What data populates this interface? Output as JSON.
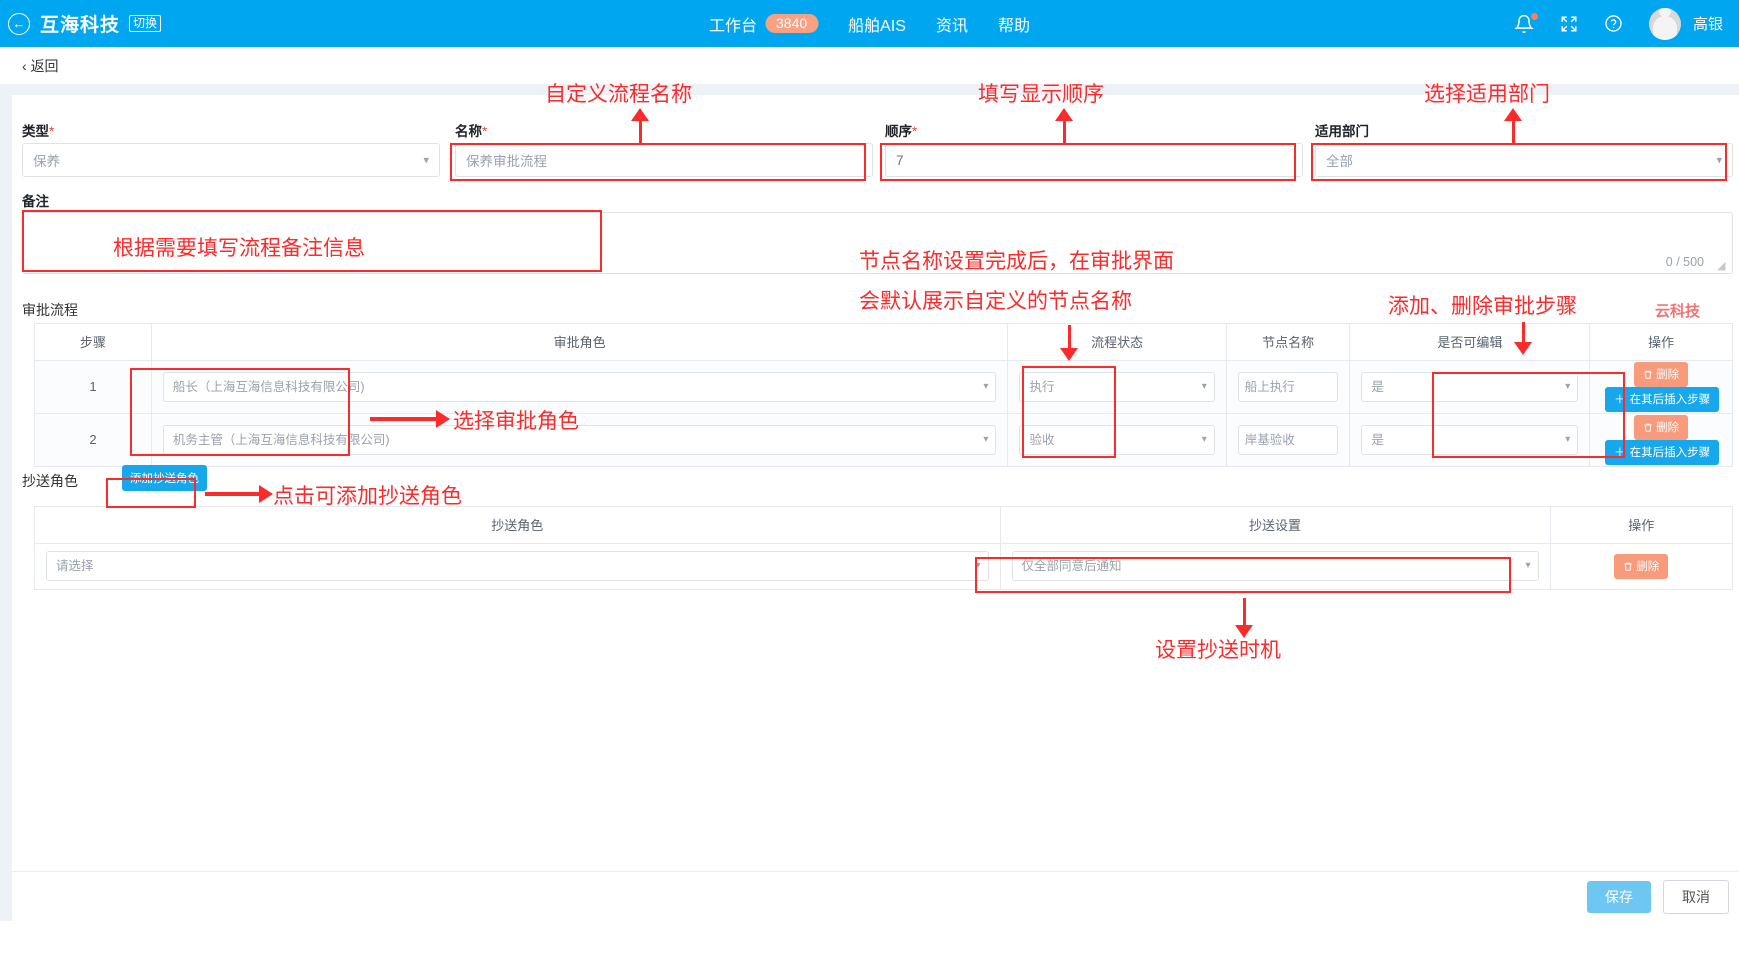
{
  "topbar": {
    "back_icon": "back-arrow-circle-icon",
    "brand": "互海科技",
    "switch_label": "切换",
    "nav": [
      {
        "label": "工作台",
        "count": "3840"
      },
      {
        "label": "船舶AIS",
        "count": ""
      },
      {
        "label": "资讯",
        "count": ""
      },
      {
        "label": "帮助",
        "count": ""
      }
    ],
    "bell_icon": "bell-icon",
    "fullscreen_icon": "fullscreen-icon",
    "help_icon": "question-circle-icon",
    "avatar_icon": "user-avatar-icon",
    "username": "高银",
    "accent": "#00a7f0"
  },
  "returnbar": {
    "label": "返回",
    "chevron": "‹"
  },
  "form": {
    "type": {
      "label": "类型",
      "required": "*",
      "value": "保养"
    },
    "name": {
      "label": "名称",
      "required": "*",
      "value": "保养审批流程"
    },
    "order": {
      "label": "顺序",
      "required": "*",
      "value": "7"
    },
    "department": {
      "label": "适用部门",
      "required": "",
      "value": "全部"
    },
    "remark": {
      "label": "备注",
      "value": "",
      "counter": "0 / 500"
    }
  },
  "approval": {
    "section_title": "审批流程",
    "headers": [
      "步骤",
      "审批角色",
      "流程状态",
      "节点名称",
      "是否可编辑",
      "操作"
    ],
    "rows": [
      {
        "step": "1",
        "role": "船长（上海互海信息科技有限公司)",
        "status": "执行",
        "node": "船上执行",
        "editable": "是",
        "delete_label": "删除",
        "insert_label": "在其后插入步骤"
      },
      {
        "step": "2",
        "role": "机务主管（上海互海信息科技有限公司)",
        "status": "验收",
        "node": "岸基验收",
        "editable": "是",
        "delete_label": "删除",
        "insert_label": "在其后插入步骤"
      }
    ]
  },
  "cc": {
    "section_title": "抄送角色",
    "add_button": "添加抄送角色",
    "headers": [
      "抄送角色",
      "抄送设置",
      "操作"
    ],
    "rows": [
      {
        "role": "请选择",
        "setting": "仅全部同意后通知",
        "delete_label": "删除"
      }
    ]
  },
  "footer": {
    "save": "保存",
    "cancel": "取消"
  },
  "annotations": {
    "custom_name": "自定义流程名称",
    "fill_order": "填写显示顺序",
    "select_department": "选择适用部门",
    "remark_hint": "根据需要填写流程备注信息",
    "node_hint_line1": "节点名称设置完成后，在审批界面",
    "node_hint_line2": "会默认展示自定义的节点名称",
    "add_delete_step": "添加、删除审批步骤",
    "select_role": "选择审批角色",
    "click_add_cc": "点击可添加抄送角色",
    "set_cc_timing": "设置抄送时机",
    "watermark": "云科技"
  }
}
